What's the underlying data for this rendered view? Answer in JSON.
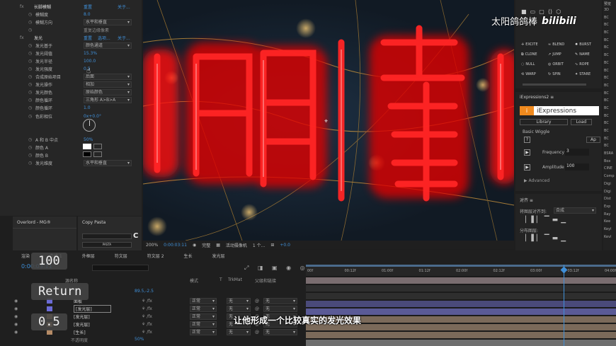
{
  "effects": {
    "rows": [
      {
        "label": "长脚模糊",
        "value": "重置",
        "extra": "关于..."
      },
      {
        "label": "模糊度",
        "value": "8.0"
      },
      {
        "label": "模糊方向",
        "value": "水平和垂直"
      },
      {
        "label": "",
        "value": "重复边缘像素"
      },
      {
        "label": "发光",
        "value": "重置",
        "extra2": "选项...",
        "extra": "关于..."
      },
      {
        "label": "发光基于",
        "value": "颜色通道"
      },
      {
        "label": "发光阈值",
        "value": "15.3%"
      },
      {
        "label": "发光半径",
        "value": "100.0"
      },
      {
        "label": "发光强度",
        "value": "0.5"
      },
      {
        "label": "合成原始项目",
        "value": "后面"
      },
      {
        "label": "发光操作",
        "value": "相加"
      },
      {
        "label": "发光颜色",
        "value": "原始颜色"
      },
      {
        "label": "颜色循环",
        "value": "三角形 A>B>A"
      },
      {
        "label": "颜色循环",
        "value": "1.0"
      },
      {
        "label": "色彩相位",
        "value": "0x+0.0°"
      },
      {
        "label": "A 和 B 中点",
        "value": "50%"
      },
      {
        "label": "颜色 A",
        "value": ""
      },
      {
        "label": "颜色 B",
        "value": ""
      },
      {
        "label": "发光维度",
        "value": "水平和垂直"
      }
    ]
  },
  "overlord": {
    "title": "Overlord - MG®"
  },
  "copypasta": {
    "title": "Copy Pasta",
    "paste_label": "PASTA",
    "c_label": "C"
  },
  "viewer": {
    "zoom": "200%",
    "timecode": "0:00:03:11",
    "quality": "完整",
    "camera": "活动摄像机",
    "views": "1 个...",
    "exposure": "+0.0",
    "big_text": "阳翻",
    "watermark": "太阳鸽鸽棒",
    "logo": "bilibili"
  },
  "motion": {
    "buttons": [
      {
        "icon": "✛",
        "label": "EXCITE"
      },
      {
        "icon": "≈",
        "label": "BLEND"
      },
      {
        "icon": "✸",
        "label": "BURST"
      },
      {
        "icon": "⧉",
        "label": "CLONE"
      },
      {
        "icon": "↗",
        "label": "JUMP"
      },
      {
        "icon": "✎",
        "label": "NAME"
      },
      {
        "icon": "◌",
        "label": "NULL"
      },
      {
        "icon": "◎",
        "label": "ORBIT"
      },
      {
        "icon": "∿",
        "label": "ROPE"
      },
      {
        "icon": "⟲",
        "label": "WARP"
      },
      {
        "icon": "↻",
        "label": "SPIN"
      },
      {
        "icon": "✦",
        "label": "STARE"
      }
    ]
  },
  "iexpressions": {
    "panel_title": "iExpressions2 ≡",
    "logo_text": "iExpressions",
    "tab_library": "Library",
    "tab_load": "Load",
    "preset_name": "Basic Wiggle",
    "apply_label": "Ap",
    "frequency_label": "Frequency",
    "frequency_value": "3",
    "amplitude_label": "Amplitude",
    "amplitude_value": "100",
    "advanced_label": "Advanced"
  },
  "align": {
    "title": "对齐 ≡",
    "align_to_label": "将图层对齐到:",
    "align_to_value": "合成",
    "distribute_label": "分布图层:"
  },
  "right_edge": {
    "header": "预览",
    "items": [
      "3D",
      "BC",
      "BC",
      "BC",
      "BC",
      "BC",
      "BC",
      "BC",
      "BC",
      "BC",
      "BC",
      "BC",
      "BC",
      "BC",
      "BC",
      "BC",
      "BC",
      "BC",
      "BC",
      "BSRA",
      "Box",
      "CINE",
      "Comp",
      "Digi",
      "Digi",
      "Dist",
      "Exp",
      "Ray",
      "Kee",
      "Keyl",
      "Kevl"
    ]
  },
  "timeline": {
    "tabs": [
      "渲染",
      "合成 1",
      "外框层",
      "符文层",
      "符文层 2",
      "生长",
      "发光层"
    ],
    "time": "0:00:03:11",
    "ruler": [
      "00f",
      "00:12f",
      "01:00f",
      "01:12f",
      "02:00f",
      "02:12f",
      "03:00f",
      "03:12f",
      "04:00f"
    ],
    "col_headers": {
      "name": "源名称",
      "mode": "模式",
      "t": "T",
      "trkmat": "TrkMat",
      "parent": "父级和链接"
    },
    "value_row": "89.5,-2.5",
    "layers": [
      {
        "name": "面板",
        "mode": "正常",
        "trk": "无",
        "parent": "无"
      },
      {
        "name": "[发光层]",
        "mode": "正常",
        "trk": "无",
        "parent": "无"
      },
      {
        "name": "[发光层]",
        "mode": "正常",
        "trk": "无",
        "parent": "无"
      },
      {
        "name": "[发光层]",
        "mode": "正常",
        "trk": "无",
        "parent": "无"
      },
      {
        "name": "[生长]",
        "mode": "正常",
        "trk": "无",
        "parent": "无"
      }
    ],
    "bottom_row": "不透明度",
    "bottom_value": "50%"
  },
  "overlay": {
    "chip_100": "100",
    "chip_return": "Return",
    "chip_05": "0.5"
  },
  "subtitle": "让他形成一个比较真实的发光效果"
}
